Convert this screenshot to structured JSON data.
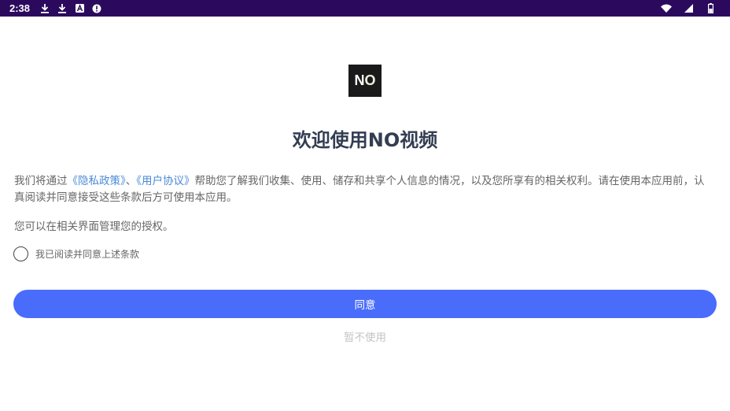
{
  "status_bar": {
    "time": "2:38",
    "left_icons": [
      "download-icon",
      "download-icon",
      "app-a-icon",
      "alert-icon"
    ],
    "right_icons": [
      "wifi-icon",
      "signal-icon",
      "battery-icon"
    ]
  },
  "logo": {
    "text_n": "N",
    "text_o": "O"
  },
  "title": "欢迎使用NO视频",
  "intro": {
    "before": "我们将通过",
    "privacy_link": "《隐私政策》",
    "sep": "、",
    "user_agreement_link": "《用户协议》",
    "after": "帮助您了解我们收集、使用、储存和共享个人信息的情况，以及您所享有的相关权利。请在使用本应用前，认真阅读并同意接受这些条款后方可使用本应用。"
  },
  "manage_text": "您可以在相关界面管理您的授权。",
  "agree_checkbox_label": "我已阅读并同意上述条款",
  "buttons": {
    "agree": "同意",
    "decline": "暂不使用"
  },
  "colors": {
    "status_bar": "#2b0a5e",
    "primary": "#4a6cfb",
    "link": "#4a8ad6",
    "title": "#333d52"
  }
}
